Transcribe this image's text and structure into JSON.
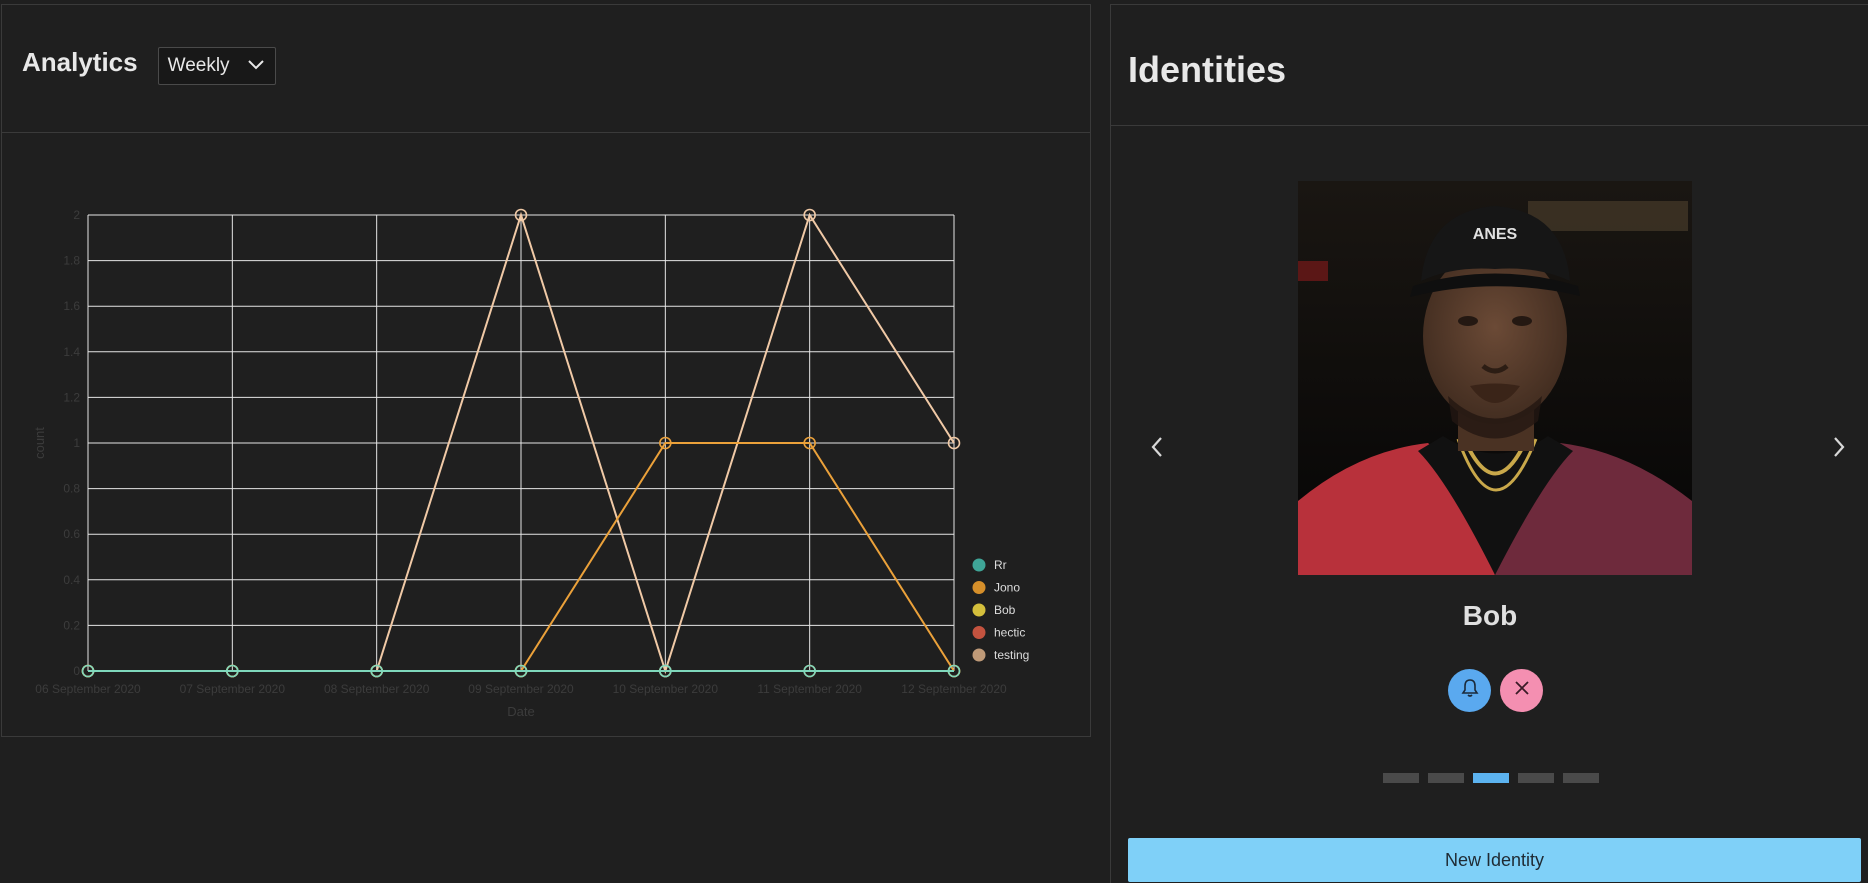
{
  "analytics": {
    "title": "Analytics",
    "period_select": {
      "value": "Weekly"
    }
  },
  "chart_data": {
    "type": "line",
    "xlabel": "Date",
    "ylabel": "count",
    "categories": [
      "06 September 2020",
      "07 September 2020",
      "08 September 2020",
      "09 September 2020",
      "10 September 2020",
      "11 September 2020",
      "12 September 2020"
    ],
    "ylim": [
      0,
      2
    ],
    "yticks": [
      "0",
      "0.2",
      "0.4",
      "0.6",
      "0.8",
      "1",
      "1.2",
      "1.4",
      "1.6",
      "1.8",
      "2"
    ],
    "grid": true,
    "legend_position": "right",
    "series": [
      {
        "name": "Rr",
        "color": "#3fa597",
        "values": [
          0,
          0,
          0,
          0,
          0,
          0,
          0
        ]
      },
      {
        "name": "Jono",
        "color": "#d68f2a",
        "values": [
          0,
          0,
          0,
          0,
          1,
          1,
          0
        ]
      },
      {
        "name": "Bob",
        "color": "#d4bf3c",
        "values": [
          0,
          0,
          0,
          0,
          0,
          0,
          0
        ]
      },
      {
        "name": "hectic",
        "color": "#c4533f",
        "values": [
          0,
          0,
          0,
          0,
          0,
          0,
          0
        ]
      },
      {
        "name": "testing",
        "color": "#bf9a78",
        "values": [
          0,
          0,
          0,
          2,
          0,
          2,
          1
        ]
      }
    ],
    "line_colors": {
      "Rr": "#7fd8bc",
      "Jono": "#eba13a",
      "testing": "#f0c9a6"
    }
  },
  "identities": {
    "title": "Identities",
    "current_name": "Bob",
    "slide_count": 5,
    "active_slide": 2,
    "new_button_label": "New Identity",
    "colors": {
      "bell_button": "#5aa9ef",
      "remove_button": "#f48fb1",
      "accent": "#7fd0f8"
    }
  }
}
